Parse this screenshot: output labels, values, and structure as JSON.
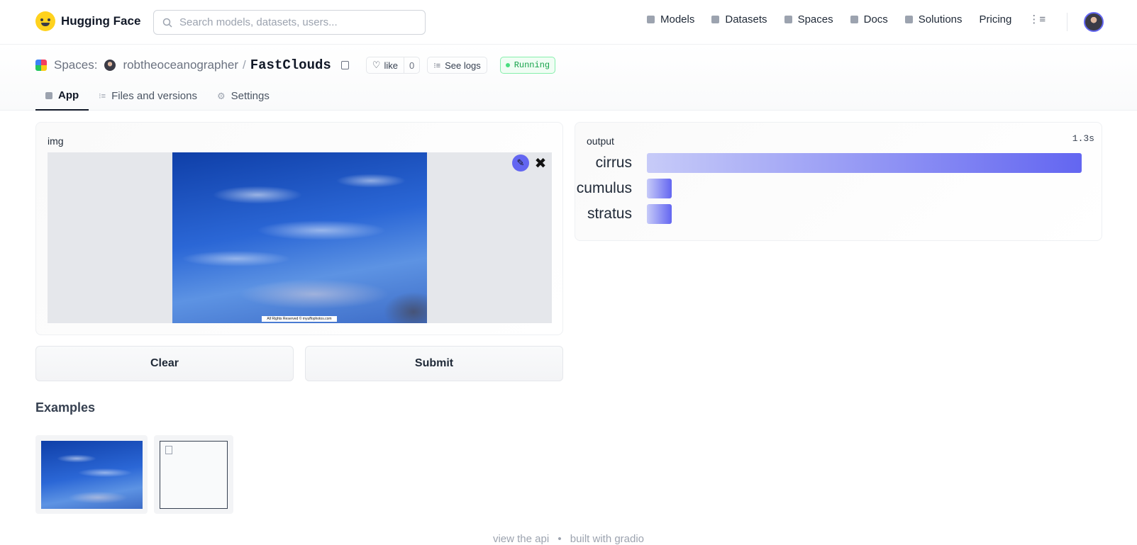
{
  "brand": {
    "name": "Hugging Face"
  },
  "search": {
    "placeholder": "Search models, datasets, users..."
  },
  "nav": {
    "items": [
      {
        "label": "Models",
        "icon": "cube-icon"
      },
      {
        "label": "Datasets",
        "icon": "database-icon"
      },
      {
        "label": "Spaces",
        "icon": "grid-icon"
      },
      {
        "label": "Docs",
        "icon": "doc-icon"
      },
      {
        "label": "Solutions",
        "icon": "briefcase-icon"
      },
      {
        "label": "Pricing"
      }
    ],
    "more_icon": "menu-icon"
  },
  "space": {
    "section_label": "Spaces:",
    "owner": "robtheoceanographer",
    "separator": "/",
    "name": "FastClouds",
    "like_label": "like",
    "like_count": "0",
    "logs_label": "See logs",
    "status": "Running"
  },
  "tabs": [
    {
      "label": "App",
      "active": true
    },
    {
      "label": "Files and versions",
      "active": false
    },
    {
      "label": "Settings",
      "active": false
    }
  ],
  "input_panel": {
    "label": "img",
    "watermark": "All Rights Reserved © myuffophotos.com"
  },
  "output_panel": {
    "label": "output",
    "timer": "1.3s",
    "results": [
      {
        "label": "cirrus",
        "confidence": 1.0
      },
      {
        "label": "cumulus",
        "confidence": 0.0
      },
      {
        "label": "stratus",
        "confidence": 0.0
      }
    ]
  },
  "buttons": {
    "clear": "Clear",
    "submit": "Submit"
  },
  "examples": {
    "title": "Examples"
  },
  "footer": {
    "api": "view the api",
    "sep": "•",
    "built": "built with gradio"
  },
  "colors": {
    "accent": "#6366f1",
    "running": "#16a34a"
  }
}
